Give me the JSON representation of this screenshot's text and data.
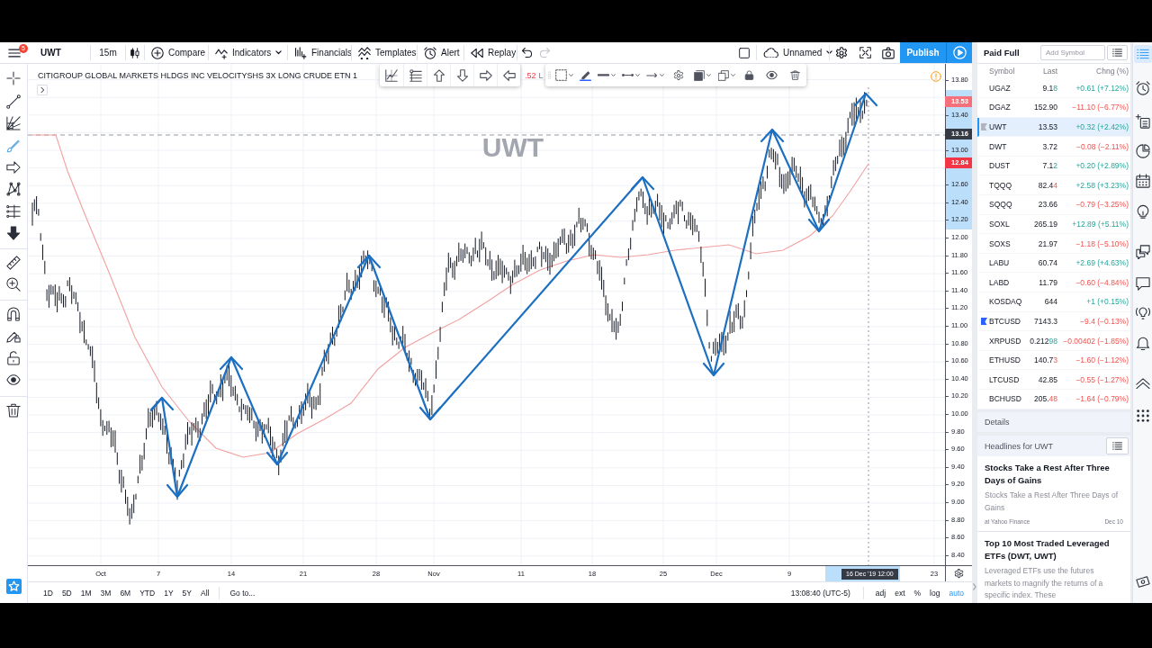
{
  "top_toolbar": {
    "notification_count": "5",
    "symbol": "UWT",
    "interval": "15m",
    "actions": [
      {
        "kind": "compare",
        "label": "Compare"
      },
      {
        "kind": "indicators",
        "label": "Indicators"
      },
      {
        "kind": "financials",
        "label": "Financials"
      },
      {
        "kind": "templates",
        "label": "Templates"
      },
      {
        "kind": "alert",
        "label": "Alert"
      },
      {
        "kind": "replay",
        "label": "Replay"
      }
    ],
    "undo": {
      "disabled": false
    },
    "redo": {
      "disabled": true
    },
    "layout_name": "Unnamed",
    "publish_label": "Publish"
  },
  "drawing_tools": [
    {
      "kind": "crosshair",
      "selected": false
    },
    {
      "kind": "trend-line",
      "selected": false
    },
    {
      "kind": "fib",
      "selected": false
    },
    {
      "kind": "brush",
      "selected": true
    },
    {
      "kind": "pattern",
      "selected": false
    },
    {
      "kind": "prediction",
      "selected": false
    },
    {
      "kind": "levels",
      "selected": false
    },
    {
      "kind": "icon",
      "selected": false
    },
    {
      "kind": "measure",
      "selected": false
    },
    {
      "kind": "zoom",
      "selected": false
    },
    {
      "kind": "magnet",
      "selected": false
    },
    {
      "kind": "drawing-mode",
      "selected": false
    },
    {
      "kind": "lock",
      "selected": false
    },
    {
      "kind": "hide",
      "selected": false
    },
    {
      "kind": "remove",
      "selected": false
    }
  ],
  "chart": {
    "legend_title": "CITIGROUP GLOBAL MARKETS HLDGS INC VELOCITYSHS 3X LONG CRUDE ETN 1",
    "legend_fragments": [
      {
        "kind": "value",
        "text": ".52"
      },
      {
        "kind": "label",
        "text": "L"
      }
    ],
    "symbol_label": "UWT",
    "price_scale": {
      "labels": [
        "13.80",
        "13.40",
        "13.00",
        "12.60",
        "12.40",
        "12.20",
        "12.00",
        "11.80",
        "11.60",
        "11.40",
        "11.20",
        "11.00",
        "10.80",
        "10.60",
        "10.40",
        "10.20",
        "10.00",
        "9.80",
        "9.60",
        "9.40",
        "9.20",
        "9.00",
        "8.80",
        "8.60",
        "8.40"
      ],
      "tags": [
        {
          "text": "13.53",
          "color": "#f5707a"
        },
        {
          "text": "13.16",
          "color": "#363a45"
        },
        {
          "text": "12.84",
          "color": "#f23645"
        }
      ]
    },
    "time_scale": {
      "labels": [
        "Oct",
        "7",
        "14",
        "21",
        "28",
        "Nov",
        "11",
        "18",
        "25",
        "Dec",
        "9",
        "23"
      ],
      "cursor_label": "16 Dec '19 12:00"
    }
  },
  "bottom_bar": {
    "ranges": [
      "1D",
      "5D",
      "1M",
      "3M",
      "6M",
      "YTD",
      "1Y",
      "5Y",
      "All"
    ],
    "goto_label": "Go to...",
    "clock": "13:08:40 (UTC-5)",
    "toggles": [
      {
        "label": "adj",
        "on": false
      },
      {
        "label": "ext",
        "on": false
      },
      {
        "label": "%",
        "on": false
      },
      {
        "label": "log",
        "on": false
      },
      {
        "label": "auto",
        "on": true
      }
    ]
  },
  "watchlist": {
    "title": "Paid Full",
    "search": {
      "placeholder": "Add Symbol"
    },
    "columns": [
      "Symbol",
      "Last",
      "Chng (%)"
    ],
    "rows": [
      {
        "symbol": "UGAZ",
        "last": "9.1",
        "last_tick": "8",
        "tick_rising": true,
        "change": "+0.61 (+7.12%)",
        "rising": true,
        "selected": false
      },
      {
        "symbol": "DGAZ",
        "last": "152.90",
        "change": "−11.10 (−6.77%)",
        "rising": false,
        "selected": false
      },
      {
        "symbol": "UWT",
        "last": "13.53",
        "change": "+0.32 (+2.42%)",
        "rising": true,
        "selected": true,
        "color": "#b2b5be"
      },
      {
        "symbol": "DWT",
        "last": "3.72",
        "change": "−0.08 (−2.11%)",
        "rising": false,
        "selected": false
      },
      {
        "symbol": "DUST",
        "last": "7.1",
        "last_tick": "2",
        "tick_rising": true,
        "change": "+0.20 (+2.89%)",
        "rising": true,
        "selected": false
      },
      {
        "symbol": "TQQQ",
        "last": "82.4",
        "last_tick": "4",
        "tick_rising": false,
        "change": "+2.58 (+3.23%)",
        "rising": true,
        "selected": false
      },
      {
        "symbol": "SQQQ",
        "last": "23.66",
        "change": "−0.79 (−3.25%)",
        "rising": false,
        "selected": false
      },
      {
        "symbol": "SOXL",
        "last": "265.19",
        "change": "+12.89 (+5.11%)",
        "rising": true,
        "selected": false
      },
      {
        "symbol": "SOXS",
        "last": "21.97",
        "change": "−1.18 (−5.10%)",
        "rising": false,
        "selected": false
      },
      {
        "symbol": "LABU",
        "last": "60.74",
        "change": "+2.69 (+4.63%)",
        "rising": true,
        "selected": false
      },
      {
        "symbol": "LABD",
        "last": "11.79",
        "change": "−0.60 (−4.84%)",
        "rising": false,
        "selected": false
      },
      {
        "symbol": "KOSDAQ",
        "last": "644",
        "change": "+1 (+0.15%)",
        "rising": true,
        "selected": false
      },
      {
        "symbol": "BTCUSD",
        "last": "7143.3",
        "change": "−9.4 (−0.13%)",
        "rising": false,
        "selected": false,
        "color": "#2962ff"
      },
      {
        "symbol": "XRPUSD",
        "last": "0.212",
        "last_tick": "98",
        "tick_rising": true,
        "change": "−0.00402 (−1.85%)",
        "rising": false,
        "selected": false
      },
      {
        "symbol": "ETHUSD",
        "last": "140.7",
        "last_tick": "3",
        "tick_rising": false,
        "change": "−1.60 (−1.12%)",
        "rising": false,
        "selected": false
      },
      {
        "symbol": "LTCUSD",
        "last": "42.85",
        "change": "−0.55 (−1.27%)",
        "rising": false,
        "selected": false
      },
      {
        "symbol": "BCHUSD",
        "last": "205.",
        "last_tick": "48",
        "tick_rising": false,
        "change": "−1.64 (−0.79%)",
        "rising": false,
        "selected": false
      }
    ]
  },
  "details": {
    "title": "Details"
  },
  "headlines": {
    "title": "Headlines for UWT",
    "items": [
      {
        "title": "Stocks Take a Rest After Three Days of Gains",
        "summary": "Stocks Take a Rest After Three Days of Gains",
        "source": "at Yahoo Finance",
        "date": "Dec 10"
      },
      {
        "title": "Top 10 Most Traded Leveraged ETFs (DWT, UWT)",
        "summary": "Leveraged ETFs use the futures markets to magnify the returns of a specific index. These"
      }
    ]
  },
  "side_panel_icons": [
    {
      "kind": "watchlist",
      "selected": true
    },
    {
      "kind": "alerts",
      "selected": false
    },
    {
      "kind": "data-window",
      "selected": false
    },
    {
      "kind": "hotlists",
      "selected": false
    },
    {
      "kind": "calendar",
      "selected": false
    },
    {
      "kind": "ideas",
      "selected": false
    },
    {
      "kind": "chats",
      "selected": false
    },
    {
      "kind": "private-chats",
      "selected": false
    },
    {
      "kind": "streams",
      "selected": false
    },
    {
      "kind": "notifications",
      "selected": false
    },
    {
      "kind": "order-panel",
      "selected": false
    },
    {
      "kind": "dom",
      "selected": false
    },
    {
      "kind": "trading",
      "selected": false
    }
  ]
}
